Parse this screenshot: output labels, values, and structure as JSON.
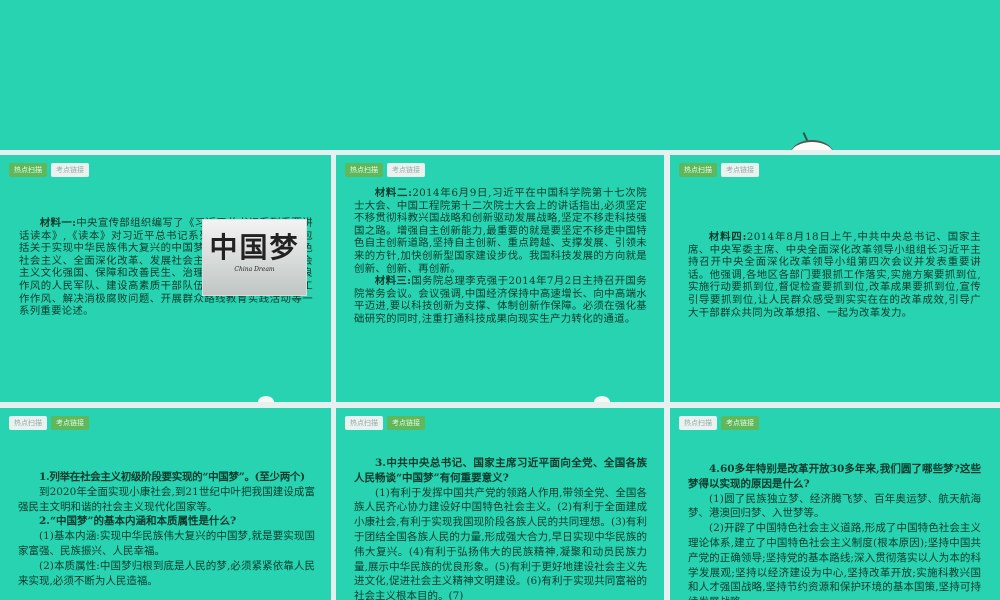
{
  "tabs": {
    "hot": "热点扫描",
    "link": "考点链接"
  },
  "image": {
    "title": "中国梦",
    "subtitle": "China Dream"
  },
  "p1": {
    "label": "材料一:",
    "text": "中央宣传部组织编写了《习近平总书记系列重要讲话读本》,《读本》对习近平总书记系列讲话进行系统解读,包括关于实现中华民族伟大复兴的中国梦、坚持和发展中国特色社会主义、全面深化改革、发展社会主义民主政治、建设社会主义文化强国、保障和改善民生、治理生态环境、建设有优良作风的人民军队、建设高素质干部队伍、执行八项规定改进工作作风、解决消极腐败问题、开展群众路线教育实践活动等一系列重要论述。"
  },
  "p2": {
    "label1": "材料二:",
    "text1": "2014年6月9日,习近平在中国科学院第十七次院士大会、中国工程院第十二次院士大会上的讲话指出,必须坚定不移贯彻科教兴国战略和创新驱动发展战略,坚定不移走科技强国之路。增强自主创新能力,最重要的就是要坚定不移走中国特色自主创新道路,坚持自主创新、重点跨越、支撑发展、引领未来的方针,加快创新型国家建设步伐。我国科技发展的方向就是创新、创新、再创新。",
    "label2": "材料三:",
    "text2": "国务院总理李克强于2014年7月2日主持召开国务院常务会议。会议强调,中国经济保持中高速增长、向中高端水平迈进,要以科技创新为支撑、体制创新作保障。必须在强化基础研究的同时,注重打通科技成果向现实生产力转化的通道。"
  },
  "p3": {
    "label": "材料四:",
    "text": "2014年8月18日上午,中共中央总书记、国家主席、中央军委主席、中央全面深化改革领导小组组长习近平主持召开中央全面深化改革领导小组第四次会议并发表重要讲话。他强调,各地区各部门要狠抓工作落实,实施方案要抓到位,实施行动要抓到位,督促检查要抓到位,改革成果要抓到位,宣传引导要抓到位,让人民群众感受到实实在在的改革成效,引导广大干部群众共同为改革想招、一起为改革发力。"
  },
  "p4": {
    "q1": "1.列举在社会主义初级阶段要实现的“中国梦”。(至少两个)",
    "a1": "到2020年全面实现小康社会,到21世纪中叶把我国建设成富强民主文明和谐的社会主义现代化国家等。",
    "q2": "2.“中国梦”的基本内涵和本质属性是什么?",
    "a2a": "(1)基本内涵:实现中华民族伟大复兴的中国梦,就是要实现国家富强、民族振兴、人民幸福。",
    "a2b": "(2)本质属性:中国梦归根到底是人民的梦,必须紧紧依靠人民来实现,必须不断为人民造福。"
  },
  "p5": {
    "q3": "3.中共中央总书记、国家主席习近平面向全党、全国各族人民畅谈“中国梦”有何重要意义?",
    "a3": "(1)有利于发挥中国共产党的领路人作用,带领全党、全国各族人民齐心协力建设好中国特色社会主义。(2)有利于全面建成小康社会,有利于实现我国现阶段各族人民的共同理想。(3)有利于团结全国各族人民的力量,形成强大合力,早日实现中华民族的伟大复兴。(4)有利于弘扬伟大的民族精神,凝聚和动员民族力量,展示中华民族的优良形象。(5)有利于更好地建设社会主义先进文化,促进社会主义精神文明建设。(6)有利于实现共同富裕的社会主义根本目的。(7)"
  },
  "p6": {
    "q4": "4.60多年特别是改革开放30多年来,我们圆了哪些梦?这些梦得以实现的原因是什么?",
    "a4a": "(1)圆了民族独立梦、经济腾飞梦、百年奥运梦、航天航海梦、港澳回归梦、入世梦等。",
    "a4b": "(2)开辟了中国特色社会主义道路,形成了中国特色社会主义理论体系,建立了中国特色社会主义制度(根本原因);坚持中国共产党的正确领导;坚持党的基本路线;深入贯彻落实以人为本的科学发展观;坚持以经济建设为中心,坚持改革开放;实施科教兴国和人才强国战略,坚持节约资源和保护环境的基本国策,坚持可持续发展战略;"
  }
}
